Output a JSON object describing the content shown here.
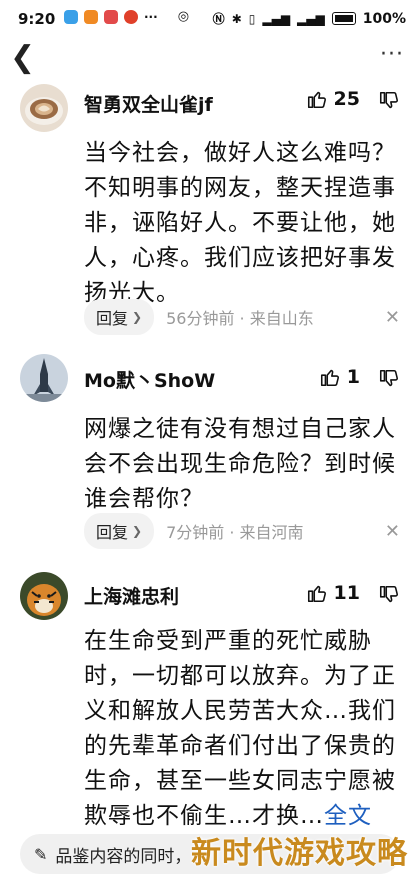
{
  "status_bar": {
    "time": "9:20",
    "battery": "100%"
  },
  "nav": {
    "back_icon": "chevron-left-icon",
    "more_icon": "ellipsis-icon"
  },
  "comments": [
    {
      "username": "智勇双全山雀jf",
      "likes": "25",
      "text": "当今社会，做好人这么难吗？不知明事的网友，整天捏造事非，诬陷好人。不要让他，她人，心疼。我们应该把好事发扬光大。",
      "reply_label": "回复",
      "meta": "56分钟前 · 来自山东"
    },
    {
      "username": "Mo默丶ShoW",
      "likes": "1",
      "text": "网爆之徒有没有想过自己家人会不会出现生命危险？到时候谁会帮你？",
      "reply_label": "回复",
      "meta": "7分钟前 · 来自河南"
    },
    {
      "username": "上海滩忠利",
      "likes": "11",
      "text": "在生命受到严重的死忙威胁时，一切都可以放弃。为了正义和解放人民劳苦大众…我们的先辈革命者们付出了保贵的生命，甚至一些女同志宁愿被欺辱也不偷生…才换…",
      "full_text_link": "全文"
    }
  ],
  "bottom_bar": {
    "placeholder": "品鉴内容的同时，"
  },
  "watermark": "新时代游戏攻略",
  "colors": {
    "link": "#1e5fbf",
    "meta": "#999999",
    "watermark": "#c98a1e"
  }
}
